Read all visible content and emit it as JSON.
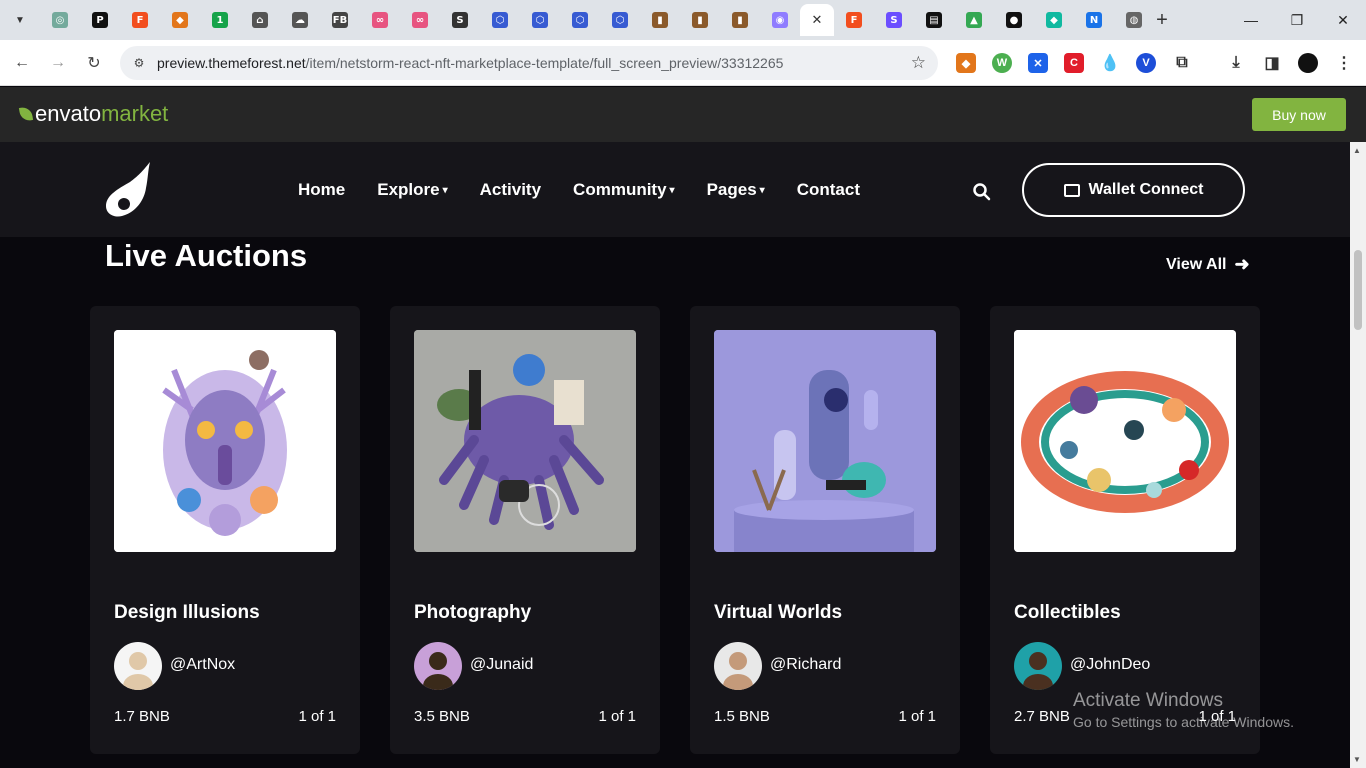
{
  "browser": {
    "tabs": [
      {
        "icon": "chatgpt-icon",
        "color": "#74aa9c",
        "glyph": "◎"
      },
      {
        "icon": "pocket-p-icon",
        "color": "#111111",
        "glyph": "P"
      },
      {
        "icon": "figma-icon",
        "color": "#f24e1e",
        "glyph": "F"
      },
      {
        "icon": "metamask-icon",
        "color": "#e2761b",
        "glyph": "◆"
      },
      {
        "icon": "one-icon",
        "color": "#16a34a",
        "glyph": "1"
      },
      {
        "icon": "house-icon",
        "color": "#555555",
        "glyph": "⌂"
      },
      {
        "icon": "cloud-icon",
        "color": "#555555",
        "glyph": "☁"
      },
      {
        "icon": "fb-icon",
        "color": "#444444",
        "glyph": "FB"
      },
      {
        "icon": "pink-logo-icon",
        "color": "#e75480",
        "glyph": "∞"
      },
      {
        "icon": "pink-logo-icon",
        "color": "#e75480",
        "glyph": "∞"
      },
      {
        "icon": "s-icon",
        "color": "#333333",
        "glyph": "S"
      },
      {
        "icon": "hexagon-icon",
        "color": "#375bd2",
        "glyph": "⬡"
      },
      {
        "icon": "hexagon-icon",
        "color": "#375bd2",
        "glyph": "⬡"
      },
      {
        "icon": "hexagon-icon",
        "color": "#375bd2",
        "glyph": "⬡"
      },
      {
        "icon": "hexagon-icon",
        "color": "#375bd2",
        "glyph": "⬡"
      },
      {
        "icon": "book-icon",
        "color": "#8b5a2b",
        "glyph": "▮"
      },
      {
        "icon": "book-icon",
        "color": "#8b5a2b",
        "glyph": "▮"
      },
      {
        "icon": "book-icon",
        "color": "#8b5a2b",
        "glyph": "▮"
      },
      {
        "icon": "unicorn-icon",
        "color": "#8f7cff",
        "glyph": "◉"
      }
    ],
    "active_tab_close": "✕",
    "tabs_after": [
      {
        "icon": "figma-icon",
        "color": "#f24e1e",
        "glyph": "F"
      },
      {
        "icon": "s-icon",
        "color": "#6b4eff",
        "glyph": "S"
      },
      {
        "icon": "notebook-icon",
        "color": "#111111",
        "glyph": "▤"
      },
      {
        "icon": "drive-icon",
        "color": "#34a853",
        "glyph": "▲"
      },
      {
        "icon": "github-icon",
        "color": "#111111",
        "glyph": "●"
      },
      {
        "icon": "diamond-icon",
        "color": "#10b9a0",
        "glyph": "◆"
      },
      {
        "icon": "n-icon",
        "color": "#1a73e8",
        "glyph": "N"
      },
      {
        "icon": "globe-icon",
        "color": "#666666",
        "glyph": "◍"
      }
    ],
    "new_tab": "+",
    "url_host": "preview.themeforest.net",
    "url_path": "/item/netstorm-react-nft-marketplace-template/full_screen_preview/33312265"
  },
  "envato": {
    "logo_main": "envato",
    "logo_accent": "market",
    "buy_now": "Buy now"
  },
  "nav": {
    "home": "Home",
    "explore": "Explore",
    "activity": "Activity",
    "community": "Community",
    "pages": "Pages",
    "contact": "Contact",
    "wallet": "Wallet Connect"
  },
  "section": {
    "title": "Live Auctions",
    "view_all": "View All"
  },
  "cards": [
    {
      "title": "Design Illusions",
      "handle": "@ArtNox",
      "price": "1.7 BNB",
      "edition": "1 of 1",
      "bg": "#ffffff"
    },
    {
      "title": "Photography",
      "handle": "@Junaid",
      "price": "3.5 BNB",
      "edition": "1 of 1",
      "bg": "#a9aaa6"
    },
    {
      "title": "Virtual Worlds",
      "handle": "@Richard",
      "price": "1.5 BNB",
      "edition": "1 of 1",
      "bg": "#9c98dc"
    },
    {
      "title": "Collectibles",
      "handle": "@JohnDeo",
      "price": "2.7 BNB",
      "edition": "1 of 1",
      "bg": "#ffffff"
    }
  ],
  "watermark": {
    "line1": "Activate Windows",
    "line2": "Go to Settings to activate Windows."
  }
}
